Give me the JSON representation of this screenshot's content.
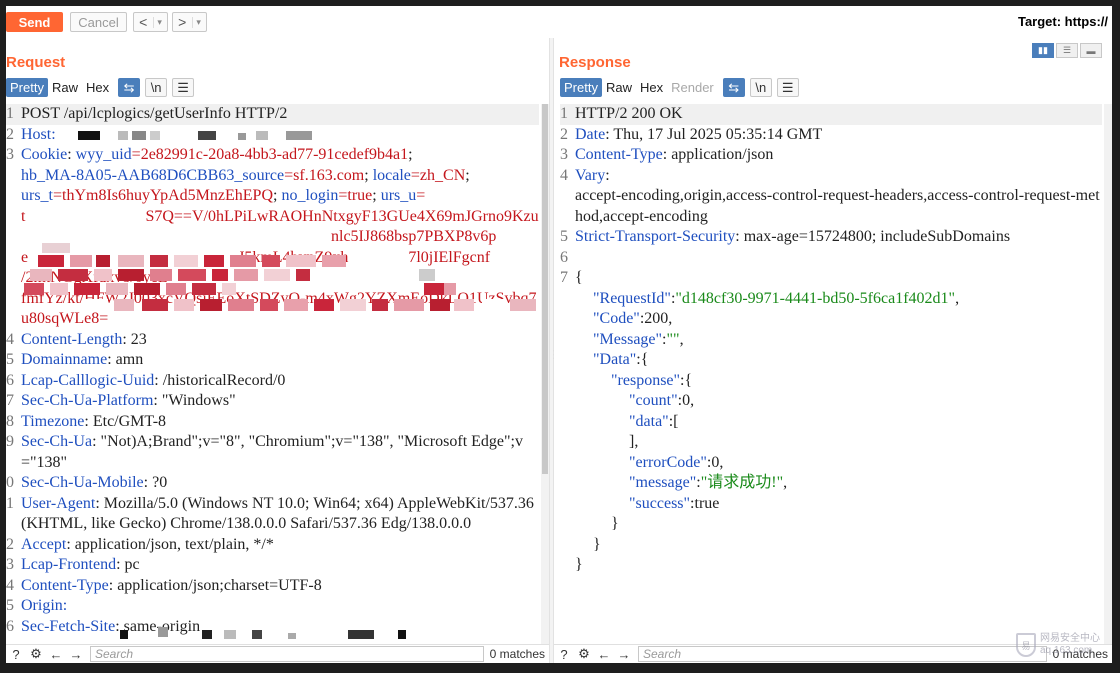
{
  "toolbar": {
    "send_label": "Send",
    "cancel_label": "Cancel",
    "back_glyph": "<",
    "forward_glyph": ">",
    "dropdown_glyph": "▾",
    "target_label": "Target: https://"
  },
  "request": {
    "title": "Request",
    "tabs": [
      "Pretty",
      "Raw",
      "Hex"
    ],
    "active_tab": "Pretty",
    "line_numbers": [
      "1",
      "2",
      "3",
      "",
      "",
      "",
      "",
      "",
      "",
      "",
      "4",
      "5",
      "6",
      "7",
      "8",
      "9",
      "",
      "0",
      "1",
      "",
      "",
      "2",
      "3",
      "4",
      "5",
      "6"
    ],
    "lines": {
      "l1": "POST /api/lcplogics/getUserInfo HTTP/2",
      "l2_name": "Host",
      "l3_name": "Cookie",
      "c1": "wyy_uid",
      "c1v": "=2e82991c-20a8-4bb3-ad77-91cedef9b4a1",
      "c2": "hb_MA-8A05-AAB68D6CBB63_source",
      "c2v": "=sf.163.com",
      "c3": "locale",
      "c3v": "=zh_CN",
      "c4": "urs_t",
      "c4v": "=thYm8Is6huyYpAd5MnzEhEPQ",
      "c5": "no_login",
      "c5v": "=true",
      "c6": "urs_u",
      "c6v": "=",
      "c7": "t",
      "c7v": "S7Q==V/0hLPiLwRAOHnNtxgyF13GUe4X69mJGrno9Kzu",
      "c8v": "nlc5IJ868bsp7PBXP8v6p",
      "c9a": "e",
      "c9b": "J5kmL4bvnZ9xh",
      "c9c": "7l0jIElFgcnf",
      "c10": "/2mtNGgXfdxv8/0yeL",
      "c11": "fmfYz/kt/HFW2J003xcVQsiEEoXtSDZvQ-m4xWg2YZXmEoDkLQ1UzSvbq7",
      "c12": "u80sqWLe8=",
      "l4_name": "Content-Length",
      "l4_val": "23",
      "l5_name": "Domainname",
      "l5_val": "amn",
      "l6_name": "Lcap-Calllogic-Uuid",
      "l6_val": "/historicalRecord/0",
      "l7_name": "Sec-Ch-Ua-Platform",
      "l7_val": "\"Windows\"",
      "l8_name": "Timezone",
      "l8_val": "Etc/GMT-8",
      "l9_name": "Sec-Ch-Ua",
      "l9_val": "\"Not)A;Brand\";v=\"8\", \"Chromium\";v=\"138\", \"Microsoft Edge\";v=\"138\"",
      "l10_name": "Sec-Ch-Ua-Mobile",
      "l10_val": "?0",
      "l11_name": "User-Agent",
      "l11_val": "Mozilla/5.0 (Windows NT 10.0; Win64; x64) AppleWebKit/537.36 (KHTML, like Gecko) Chrome/138.0.0.0 Safari/537.36 Edg/138.0.0.0",
      "l12_name": "Accept",
      "l12_val": "application/json, text/plain, */*",
      "l13_name": "Lcap-Frontend",
      "l13_val": "pc",
      "l14_name": "Content-Type",
      "l14_val": "application/json;charset=UTF-8",
      "l15_name": "Origin",
      "l16_name": "Sec-Fetch-Site",
      "l16_val": "same-origin"
    },
    "search_placeholder": "Search",
    "matches": "0 matches"
  },
  "response": {
    "title": "Response",
    "tabs": [
      "Pretty",
      "Raw",
      "Hex",
      "Render"
    ],
    "active_tab": "Pretty",
    "line_numbers": [
      "1",
      "2",
      "3",
      "4",
      "",
      "",
      "5",
      "",
      "6",
      "7"
    ],
    "lines": {
      "l1": "HTTP/2 200 OK",
      "l2_name": "Date",
      "l2_val": "Thu, 17 Jul 2025 05:35:14 GMT",
      "l3_name": "Content-Type",
      "l3_val": "application/json",
      "l4_name": "Vary",
      "l4_val": "accept-encoding,origin,access-control-request-headers,access-control-request-method,accept-encoding",
      "l5_name": "Strict-Transport-Security",
      "l5_val": "max-age=15724800; includeSubDomains",
      "j_open": "{",
      "k_requestid": "\"RequestId\"",
      "v_requestid": "\"d148cf30-9971-4441-bd50-5f6ca1f402d1\"",
      "k_code": "\"Code\"",
      "v_code": "200",
      "k_message": "\"Message\"",
      "v_message": "\"\"",
      "k_data": "\"Data\"",
      "k_response": "\"response\"",
      "k_count": "\"count\"",
      "v_count": "0",
      "k_data2": "\"data\"",
      "k_errorcode": "\"errorCode\"",
      "v_errorcode": "0",
      "k_message2": "\"message\"",
      "v_message2": "\"请求成功!\"",
      "k_success": "\"success\"",
      "v_success": "true"
    },
    "search_placeholder": "Search",
    "matches": "0 matches"
  },
  "watermark": {
    "line1": "网易安全中心",
    "line2": "aq.163.com"
  },
  "colors": {
    "accent": "#ff6633",
    "active_tab": "#4a7ebb",
    "header_name": "#1f4fbf",
    "cookie_value": "#c4161c",
    "json_string": "#1a8a1a"
  }
}
